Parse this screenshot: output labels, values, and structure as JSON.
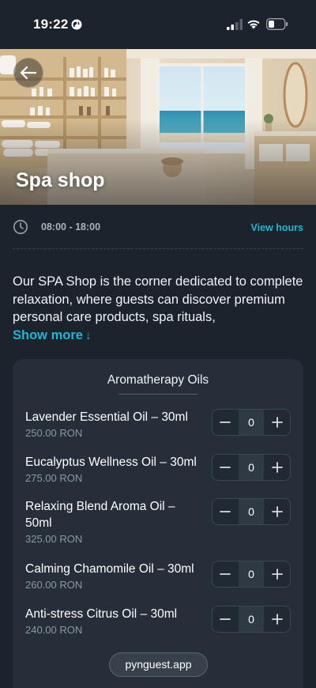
{
  "status_bar": {
    "time": "19:22"
  },
  "hero": {
    "title": "Spa shop"
  },
  "hours": {
    "text": "08:00 - 18:00",
    "view_hours_label": "View hours"
  },
  "description": {
    "text": "Our SPA Shop is the corner dedicated to complete relaxation, where guests can discover premium personal care products, spa rituals,",
    "show_more_label": "Show more",
    "show_more_arrow": "↓"
  },
  "category": {
    "title": "Aromatherapy Oils",
    "products": [
      {
        "name": "Lavender Essential Oil – 30ml",
        "price": "250.00 RON",
        "quantity": "0"
      },
      {
        "name": "Eucalyptus Wellness Oil – 30ml",
        "price": "275.00 RON",
        "quantity": "0"
      },
      {
        "name": "Relaxing Blend Aroma Oil – 50ml",
        "price": "325.00 RON",
        "quantity": "0"
      },
      {
        "name": "Calming Chamomile Oil – 30ml",
        "price": "260.00 RON",
        "quantity": "0"
      },
      {
        "name": "Anti-stress Citrus Oil – 30ml",
        "price": "240.00 RON",
        "quantity": "0"
      }
    ]
  },
  "footer": {
    "url": "pynguest.app"
  },
  "colors": {
    "background": "#1b232c",
    "card": "#262f39",
    "accent": "#1fb6d8",
    "muted_text": "#8d97a2"
  },
  "icons": [
    "globe-icon",
    "signal-icon",
    "wifi-icon",
    "battery-icon",
    "back-arrow-icon",
    "clock-icon",
    "minus-icon",
    "plus-icon"
  ]
}
